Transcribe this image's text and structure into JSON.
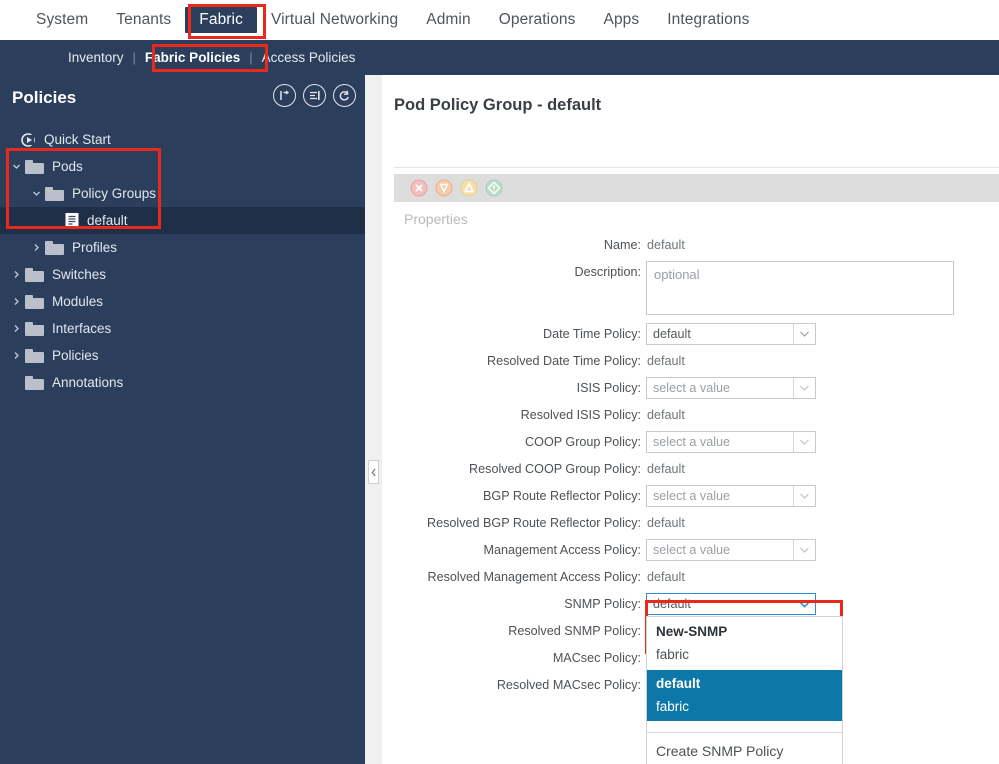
{
  "topnav": {
    "items": [
      {
        "label": "System",
        "active": false
      },
      {
        "label": "Tenants",
        "active": false
      },
      {
        "label": "Fabric",
        "active": true
      },
      {
        "label": "Virtual Networking",
        "active": false
      },
      {
        "label": "Admin",
        "active": false
      },
      {
        "label": "Operations",
        "active": false
      },
      {
        "label": "Apps",
        "active": false
      },
      {
        "label": "Integrations",
        "active": false
      }
    ]
  },
  "subnav": {
    "items": [
      {
        "label": "Inventory",
        "active": false
      },
      {
        "label": "Fabric Policies",
        "active": true
      },
      {
        "label": "Access Policies",
        "active": false
      }
    ],
    "separator": "|"
  },
  "sidebar": {
    "title": "Policies",
    "tools": [
      {
        "name": "collapse-all-icon"
      },
      {
        "name": "show-hidden-icon"
      },
      {
        "name": "refresh-icon"
      }
    ],
    "tree": [
      {
        "label": "Quick Start",
        "indent": 0,
        "icon": "quick-start-icon",
        "caret": "none",
        "selected": false
      },
      {
        "label": "Pods",
        "indent": 0,
        "icon": "folder",
        "caret": "down",
        "selected": false
      },
      {
        "label": "Policy Groups",
        "indent": 1,
        "icon": "folder",
        "caret": "down",
        "selected": false
      },
      {
        "label": "default",
        "indent": 2,
        "icon": "document",
        "caret": "none",
        "selected": true
      },
      {
        "label": "Profiles",
        "indent": 1,
        "icon": "folder",
        "caret": "right",
        "selected": false
      },
      {
        "label": "Switches",
        "indent": 0,
        "icon": "folder",
        "caret": "right",
        "selected": false
      },
      {
        "label": "Modules",
        "indent": 0,
        "icon": "folder",
        "caret": "right",
        "selected": false
      },
      {
        "label": "Interfaces",
        "indent": 0,
        "icon": "folder",
        "caret": "right",
        "selected": false
      },
      {
        "label": "Policies",
        "indent": 0,
        "icon": "folder",
        "caret": "right",
        "selected": false
      },
      {
        "label": "Annotations",
        "indent": 0,
        "icon": "folder",
        "caret": "none",
        "selected": false
      }
    ]
  },
  "main": {
    "page_title": "Pod Policy Group - default",
    "properties_label": "Properties",
    "fault_icons": [
      {
        "name": "critical-fault-icon",
        "color": "#e4a0a0"
      },
      {
        "name": "major-fault-icon",
        "color": "#edb089"
      },
      {
        "name": "minor-fault-icon",
        "color": "#ecd08a"
      },
      {
        "name": "warning-fault-icon",
        "color": "#a8ceb9"
      }
    ],
    "fields": [
      {
        "label": "Name:",
        "type": "text",
        "value": "default"
      },
      {
        "label": "Description:",
        "type": "textarea",
        "placeholder": "optional"
      },
      {
        "label": "Date Time Policy:",
        "type": "select",
        "value": "default",
        "placeholder_state": false,
        "extlink": true
      },
      {
        "label": "Resolved Date Time Policy:",
        "type": "text",
        "value": "default"
      },
      {
        "label": "ISIS Policy:",
        "type": "select",
        "value": "select a value",
        "placeholder_state": true,
        "extlink": false
      },
      {
        "label": "Resolved ISIS Policy:",
        "type": "text",
        "value": "default"
      },
      {
        "label": "COOP Group Policy:",
        "type": "select",
        "value": "select a value",
        "placeholder_state": true,
        "extlink": false
      },
      {
        "label": "Resolved COOP Group Policy:",
        "type": "text",
        "value": "default"
      },
      {
        "label": "BGP Route Reflector Policy:",
        "type": "select",
        "value": "select a value",
        "placeholder_state": true,
        "extlink": false
      },
      {
        "label": "Resolved BGP Route Reflector Policy:",
        "type": "text",
        "value": "default"
      },
      {
        "label": "Management Access Policy:",
        "type": "select",
        "value": "select a value",
        "placeholder_state": true,
        "extlink": false
      },
      {
        "label": "Resolved Management Access Policy:",
        "type": "text",
        "value": "default"
      },
      {
        "label": "SNMP Policy:",
        "type": "select-open",
        "value": "default",
        "placeholder_state": false,
        "extlink": true
      },
      {
        "label": "Resolved SNMP Policy:",
        "type": "blank",
        "value": ""
      },
      {
        "label": "MACsec Policy:",
        "type": "blank",
        "value": ""
      },
      {
        "label": "Resolved MACsec Policy:",
        "type": "blank",
        "value": ""
      }
    ],
    "snmp_dropdown": {
      "group_a": [
        {
          "label": "New-SNMP",
          "bold": true
        },
        {
          "label": "fabric",
          "bold": false
        }
      ],
      "group_b": [
        {
          "label": "default",
          "bold": true
        },
        {
          "label": "fabric",
          "bold": false
        }
      ],
      "create_label": "Create SNMP Policy"
    }
  },
  "colors": {
    "nav_navy": "#2b3f5c",
    "annotation_red": "#e8291c",
    "dropdown_blue": "#0d77a8",
    "focus_blue": "#2b8fd4",
    "selected_row": "#1e2f47"
  }
}
